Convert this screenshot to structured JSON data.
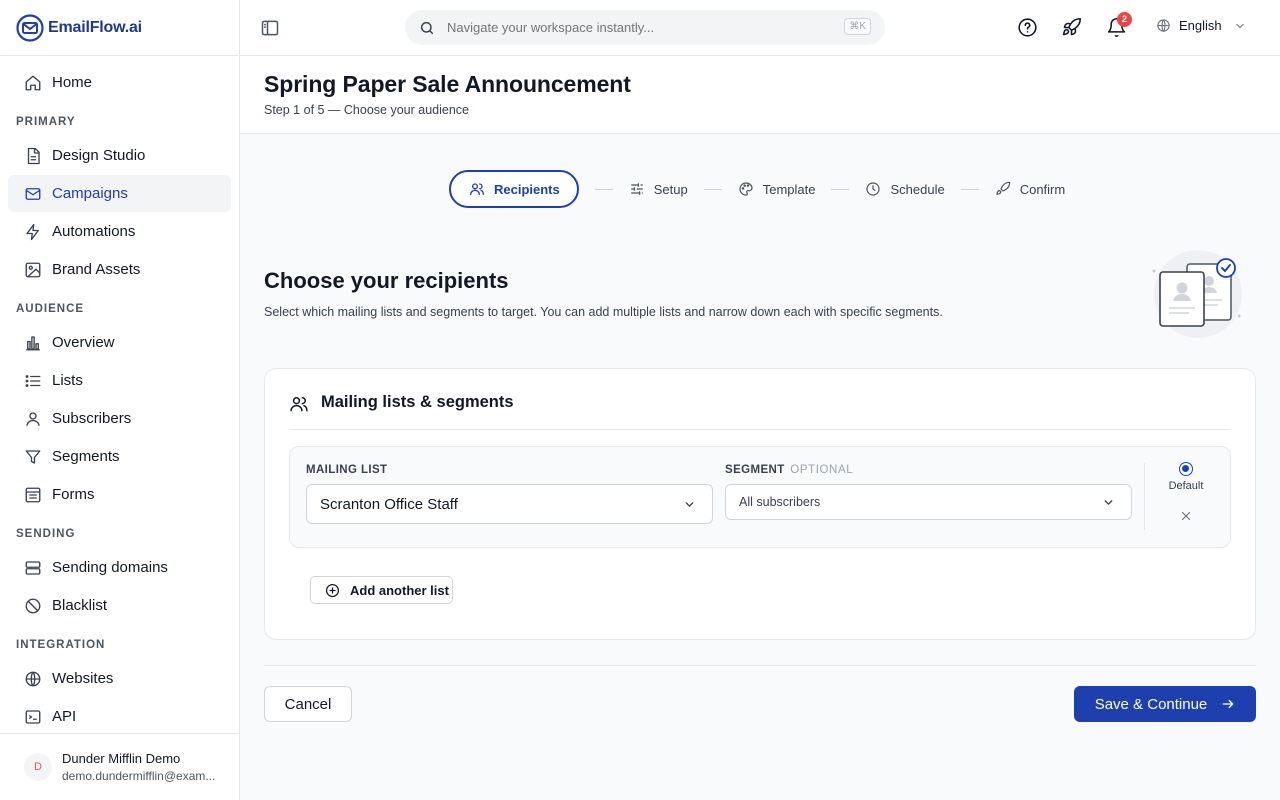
{
  "app": {
    "name": "EmailFlow.ai"
  },
  "sidebar": {
    "home": "Home",
    "sections": {
      "primary": "PRIMARY",
      "audience": "AUDIENCE",
      "sending": "SENDING",
      "integration": "INTEGRATION"
    },
    "items": {
      "design_studio": "Design Studio",
      "campaigns": "Campaigns",
      "automations": "Automations",
      "brand_assets": "Brand Assets",
      "overview": "Overview",
      "lists": "Lists",
      "subscribers": "Subscribers",
      "segments": "Segments",
      "forms": "Forms",
      "sending_domains": "Sending domains",
      "blacklist": "Blacklist",
      "websites": "Websites",
      "api": "API"
    },
    "active_item": "Campaigns",
    "user": {
      "initial": "D",
      "name": "Dunder Mifflin Demo",
      "email": "demo.dundermifflin@exam..."
    }
  },
  "topbar": {
    "search_placeholder": "Navigate your workspace instantly...",
    "search_shortcut": "⌘K",
    "notification_count": "2",
    "language": "English"
  },
  "page": {
    "title": "Spring Paper Sale Announcement",
    "subtitle": "Step 1 of 5 — Choose your audience"
  },
  "stepper": {
    "steps": [
      {
        "label": "Recipients",
        "icon": "users-icon",
        "active": true
      },
      {
        "label": "Setup",
        "icon": "sliders-icon",
        "active": false
      },
      {
        "label": "Template",
        "icon": "palette-icon",
        "active": false
      },
      {
        "label": "Schedule",
        "icon": "clock-icon",
        "active": false
      },
      {
        "label": "Confirm",
        "icon": "rocket-icon",
        "active": false
      }
    ]
  },
  "content": {
    "title": "Choose your recipients",
    "description": "Select which mailing lists and segments to target. You can add multiple lists and narrow down each with specific segments."
  },
  "card": {
    "title": "Mailing lists & segments",
    "mailing_list_label": "MAILING LIST",
    "segment_label": "SEGMENT",
    "segment_optional": "OPTIONAL",
    "mailing_list_value": "Scranton Office Staff",
    "segment_value": "All subscribers",
    "default_label": "Default",
    "add_button": "Add another list"
  },
  "footer": {
    "cancel": "Cancel",
    "save": "Save & Continue"
  },
  "colors": {
    "accent": "#1e40af",
    "badge": "#ef4444",
    "sidebar_active_bg": "#f3f4f6"
  }
}
